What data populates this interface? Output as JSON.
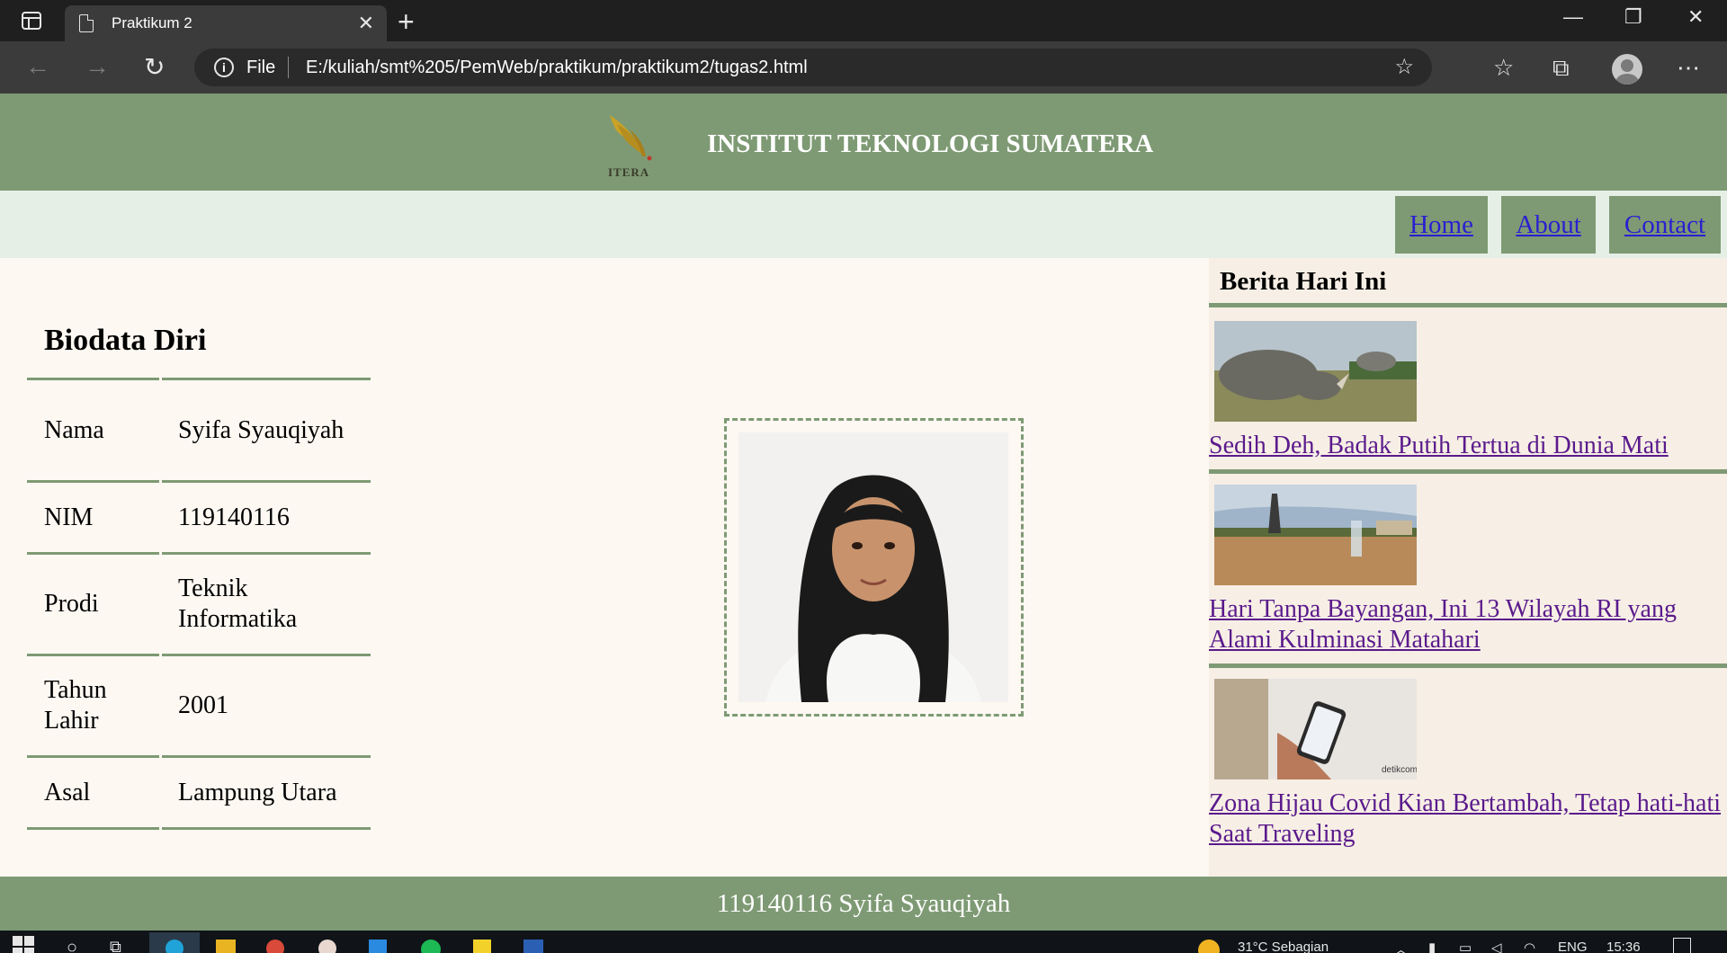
{
  "browser": {
    "tab_title": "Praktikum 2",
    "address_protocol": "File",
    "address_url": "E:/kuliah/smt%205/PemWeb/praktikum/praktikum2/tugas2.html"
  },
  "header": {
    "logo_text": "ITERA",
    "title": "INSTITUT TEKNOLOGI SUMATERA"
  },
  "nav": {
    "items": [
      "Home",
      "About",
      "Contact"
    ]
  },
  "biodata": {
    "title": "Biodata Diri",
    "rows": [
      {
        "label": "Nama",
        "value": "Syifa Syauqiyah"
      },
      {
        "label": "NIM",
        "value": "119140116"
      },
      {
        "label": "Prodi",
        "value": "Teknik Informatika"
      },
      {
        "label": "Tahun Lahir",
        "value": "2001"
      },
      {
        "label": "Asal",
        "value": "Lampung Utara"
      }
    ]
  },
  "news": {
    "title": "Berita Hari Ini",
    "items": [
      {
        "headline": "Sedih Deh, Badak Putih Tertua di Dunia Mati"
      },
      {
        "headline": "Hari Tanpa Bayangan, Ini 13 Wilayah RI yang Alami Kulminasi Matahari"
      },
      {
        "headline": "Zona Hijau Covid Kian Bertambah, Tetap hati-hati Saat Traveling"
      }
    ]
  },
  "footer": {
    "text": "119140116 Syifa Syauqiyah"
  },
  "taskbar": {
    "weather": "31°C  Sebagian",
    "language": "ENG",
    "time": "15:36"
  },
  "colors": {
    "accent_green": "#7e9a74",
    "nav_bg": "#e5efe6",
    "page_bg": "#fdf8f2",
    "news_bg": "#f7efe5",
    "link_blue": "#2a1fd1",
    "visited_purple": "#5a1a8c"
  }
}
